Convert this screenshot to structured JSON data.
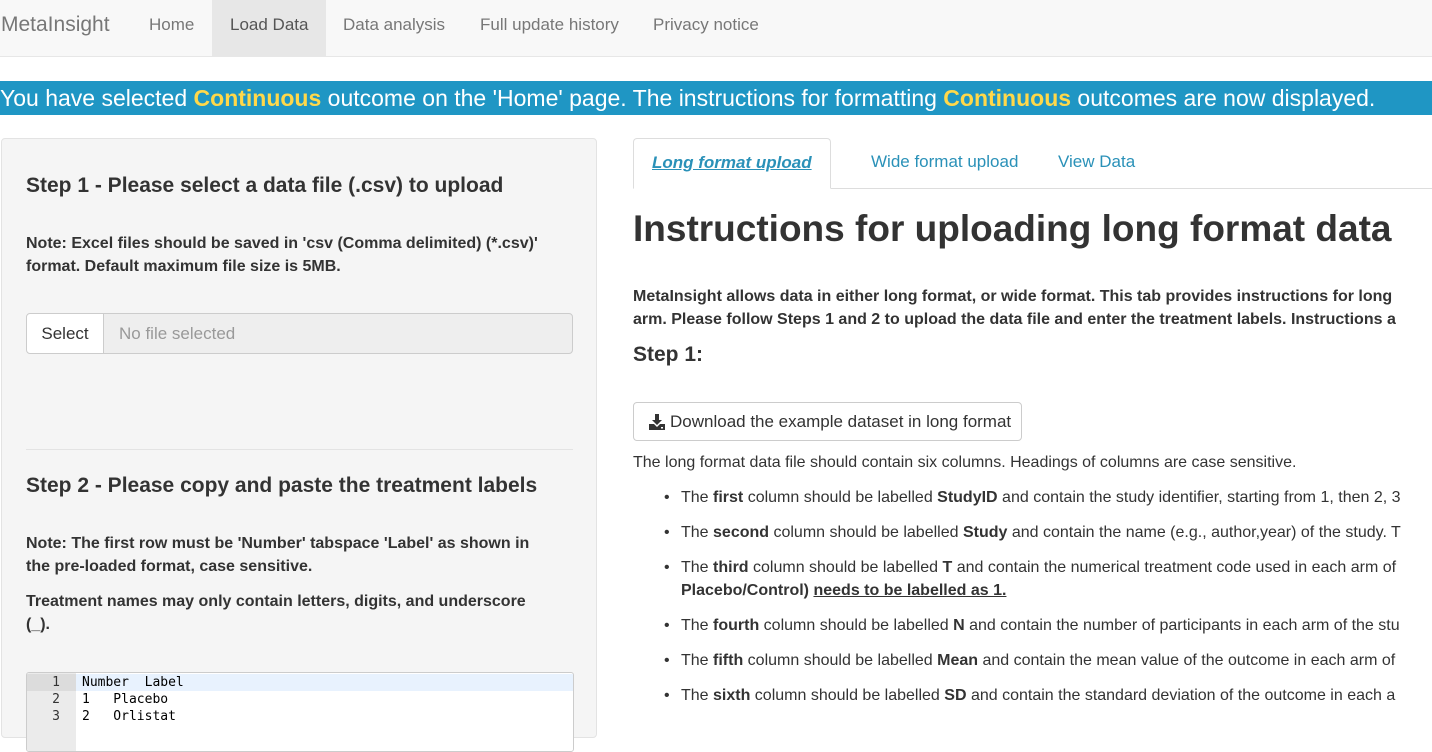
{
  "navbar": {
    "brand": "MetaInsight",
    "items": [
      {
        "label": "Home"
      },
      {
        "label": "Load Data"
      },
      {
        "label": "Data analysis"
      },
      {
        "label": "Full update history"
      },
      {
        "label": "Privacy notice"
      }
    ],
    "active": "Load Data"
  },
  "banner": {
    "part1": "You have selected ",
    "highlight1": "Continuous",
    "part2": " outcome on the 'Home' page. The instructions for formatting ",
    "highlight2": "Continuous",
    "part3": " outcomes are now displayed.",
    "background": "#1f96c4",
    "highlight_color": "#ffd84a"
  },
  "sidebar": {
    "step1_title": "Step 1 - Please select a data file (.csv) to upload",
    "step1_note_line1": "Note: Excel files should be saved in 'csv (Comma delimited) (*.csv)'",
    "step1_note_line2": "format. Default maximum file size is 5MB.",
    "file_button": "Select",
    "file_placeholder": "No file selected",
    "step2_title": "Step 2 - Please copy and paste the treatment labels",
    "step2_note_line1": "Note: The first row must be 'Number' tabspace 'Label' as shown in",
    "step2_note_line2": "the pre-loaded format, case sensitive.",
    "step2_note2_line1": "Treatment names may only contain letters, digits, and underscore",
    "step2_note2_line2": "(_).",
    "editor_lines": [
      {
        "num": "1",
        "text": "Number  Label"
      },
      {
        "num": "2",
        "text": "1   Placebo"
      },
      {
        "num": "3",
        "text": "2   Orlistat"
      }
    ]
  },
  "main": {
    "tabs": [
      {
        "label": "Long format upload"
      },
      {
        "label": "Wide format upload"
      },
      {
        "label": "View Data"
      }
    ],
    "active_tab": "Long format upload",
    "title": "Instructions for uploading long format data",
    "intro_line1": "MetaInsight allows data in either long format, or wide format. This tab provides instructions for long",
    "intro_line2": "arm. Please follow Steps 1 and 2 to upload the data file and enter the treatment labels. Instructions a",
    "step1_heading": "Step 1:",
    "download_button": "Download the example dataset in long format",
    "description": "The long format data file should contain six columns. Headings of columns are case sensitive.",
    "columns": [
      {
        "pre": "The ",
        "ordinal": "first",
        "mid": " column should be labelled ",
        "name": "StudyID",
        "post": " and contain the study identifier, starting from 1, then 2, 3"
      },
      {
        "pre": "The ",
        "ordinal": "second",
        "mid": " column should be labelled ",
        "name": "Study",
        "post": " and contain the name (e.g., author,year) of the study. T"
      },
      {
        "pre": "The ",
        "ordinal": "third",
        "mid": " column should be labelled ",
        "name": "T",
        "post": " and contain the numerical treatment code used in each arm of",
        "line2_bold": "Placebo/Control)",
        "line2_underline": "needs to be labelled as 1."
      },
      {
        "pre": "The ",
        "ordinal": "fourth",
        "mid": " column should be labelled ",
        "name": "N",
        "post": " and contain the number of participants in each arm of the stu"
      },
      {
        "pre": "The ",
        "ordinal": "fifth",
        "mid": " column should be labelled ",
        "name": "Mean",
        "post": " and contain the mean value of the outcome in each arm of"
      },
      {
        "pre": "The ",
        "ordinal": "sixth",
        "mid": " column should be labelled ",
        "name": "SD",
        "post": " and contain the standard deviation of the outcome in each a"
      }
    ]
  },
  "icons": {
    "download": "download-icon"
  }
}
